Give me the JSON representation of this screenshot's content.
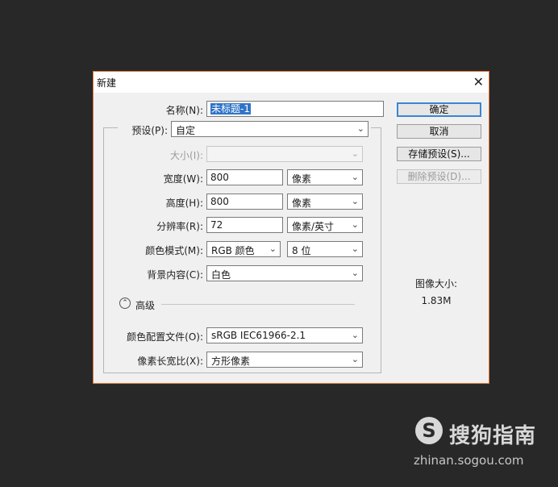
{
  "dialog": {
    "title": "新建",
    "close_glyph": "✕",
    "name": {
      "label": "名称(N):",
      "value": "未标题-1"
    },
    "preset": {
      "label": "预设(P):",
      "value": "自定"
    },
    "size": {
      "label": "大小(I):",
      "value": ""
    },
    "width": {
      "label": "宽度(W):",
      "value": "800",
      "unit": "像素"
    },
    "height": {
      "label": "高度(H):",
      "value": "800",
      "unit": "像素"
    },
    "resolution": {
      "label": "分辨率(R):",
      "value": "72",
      "unit": "像素/英寸"
    },
    "color_mode": {
      "label": "颜色模式(M):",
      "mode": "RGB 颜色",
      "depth": "8 位"
    },
    "background": {
      "label": "背景内容(C):",
      "value": "白色"
    },
    "advanced": {
      "icon_glyph": "⌃",
      "label": "高级"
    },
    "color_profile": {
      "label": "颜色配置文件(O):",
      "value": "sRGB IEC61966-2.1"
    },
    "pixel_aspect": {
      "label": "像素长宽比(X):",
      "value": "方形像素"
    },
    "buttons": {
      "ok": "确定",
      "cancel": "取消",
      "save_preset": "存储预设(S)...",
      "delete_preset": "删除预设(D)..."
    },
    "image_size": {
      "label": "图像大小:",
      "value": "1.83M"
    }
  },
  "watermark": {
    "logo_glyph": "S",
    "text": "搜狗指南",
    "url": "zhinan.sogou.com"
  },
  "colors": {
    "background": "#282828",
    "dialog": "#f0f0f0",
    "border_accent": "#e07a3c",
    "selection": "#3074c8",
    "primary_button_border": "#3a85d4"
  },
  "icons": {
    "dropdown": "chevron-down-icon",
    "advanced": "collapse-chevron-icon",
    "close": "close-icon"
  }
}
